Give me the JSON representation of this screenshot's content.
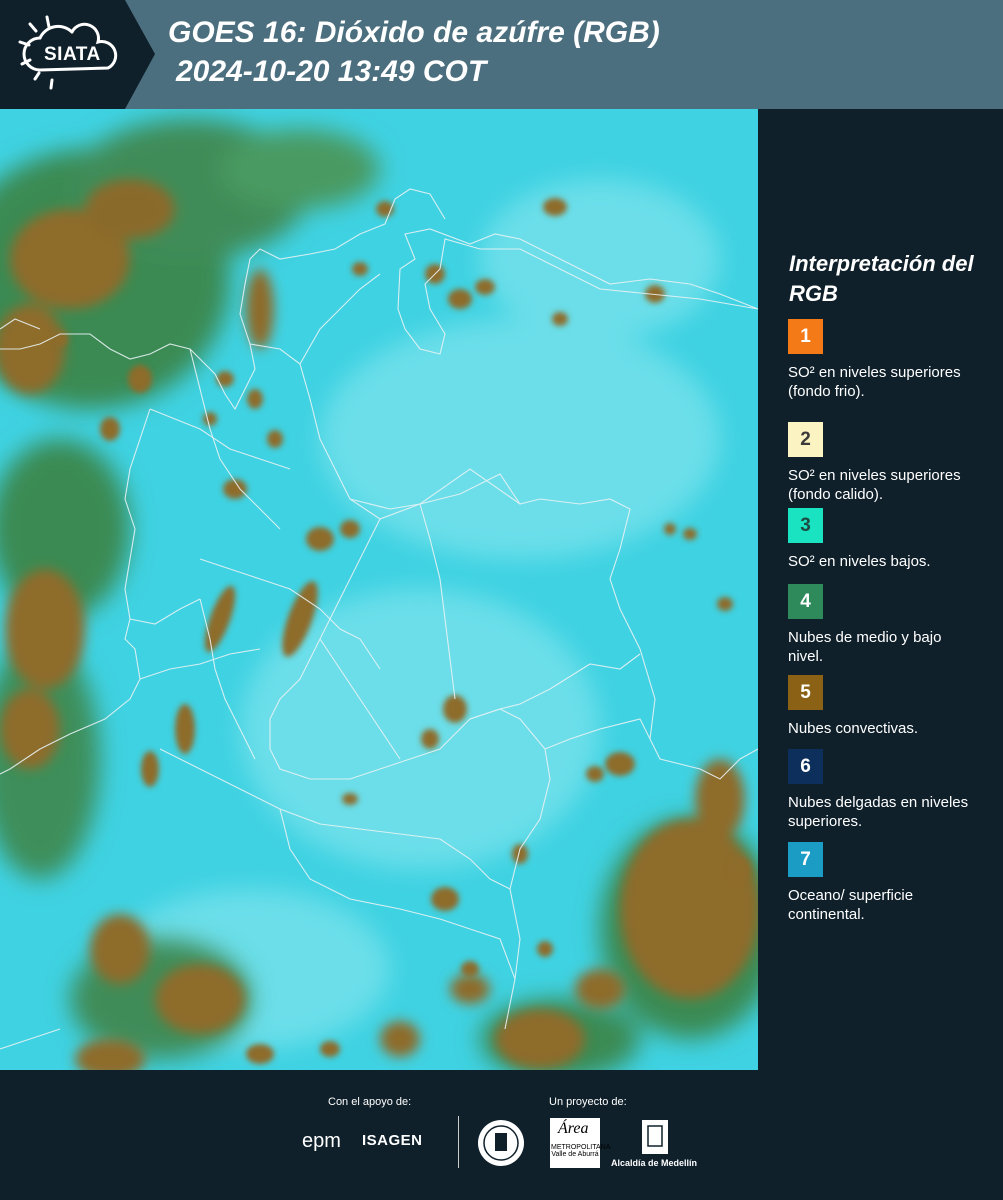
{
  "header": {
    "logo_text": "SIATA",
    "title_line1": "GOES 16: Dióxido de azúfre (RGB)",
    "title_line2": "2024-10-20 13:49 COT"
  },
  "map": {
    "background_color": "#3fd2e2",
    "cloud_color": "#8e6c2b",
    "green_cloud_color": "#3b8a52",
    "border_color": "#e8f2f4"
  },
  "legend": {
    "title": "Interpretación del RGB",
    "items": [
      {
        "number": "1",
        "color": "#f47a17",
        "text_color": "#ffffff",
        "label": "SO² en niveles superiores (fondo frio)."
      },
      {
        "number": "2",
        "color": "#fbf3c1",
        "text_color": "#3a3a3a",
        "label": "SO² en niveles superiores (fondo calido)."
      },
      {
        "number": "3",
        "color": "#19e3c0",
        "text_color": "#1e4a44",
        "label": "SO² en niveles bajos."
      },
      {
        "number": "4",
        "color": "#2f8a5b",
        "text_color": "#ffffff",
        "label": "Nubes de medio y bajo nivel."
      },
      {
        "number": "5",
        "color": "#8b6116",
        "text_color": "#ffffff",
        "label": "Nubes convectivas."
      },
      {
        "number": "6",
        "color": "#0d2f5c",
        "text_color": "#ffffff",
        "label": "Nubes delgadas en niveles superiores."
      },
      {
        "number": "7",
        "color": "#1a9cc4",
        "text_color": "#ffffff",
        "label": "Oceano/ superficie continental."
      }
    ]
  },
  "footer": {
    "support_label": "Con el apoyo de:",
    "project_label": "Un proyecto de:",
    "epm": "epm",
    "isagen": "ISAGEN",
    "area_name": "METROPOLITANA Valle de Aburrá",
    "alcaldia": "Alcaldía de Medellín",
    "area_script": "Área"
  }
}
